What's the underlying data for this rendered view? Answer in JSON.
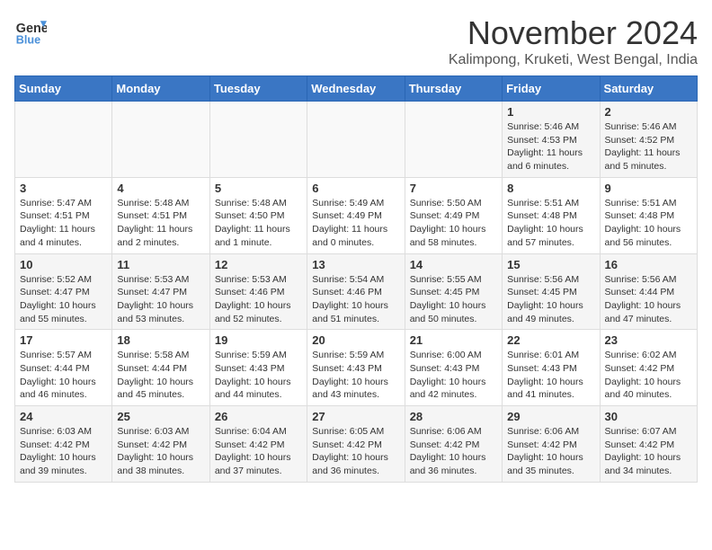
{
  "header": {
    "logo_line1": "General",
    "logo_line2": "Blue",
    "month": "November 2024",
    "location": "Kalimpong, Kruketi, West Bengal, India"
  },
  "weekdays": [
    "Sunday",
    "Monday",
    "Tuesday",
    "Wednesday",
    "Thursday",
    "Friday",
    "Saturday"
  ],
  "weeks": [
    [
      {
        "day": "",
        "info": ""
      },
      {
        "day": "",
        "info": ""
      },
      {
        "day": "",
        "info": ""
      },
      {
        "day": "",
        "info": ""
      },
      {
        "day": "",
        "info": ""
      },
      {
        "day": "1",
        "info": "Sunrise: 5:46 AM\nSunset: 4:53 PM\nDaylight: 11 hours\nand 6 minutes."
      },
      {
        "day": "2",
        "info": "Sunrise: 5:46 AM\nSunset: 4:52 PM\nDaylight: 11 hours\nand 5 minutes."
      }
    ],
    [
      {
        "day": "3",
        "info": "Sunrise: 5:47 AM\nSunset: 4:51 PM\nDaylight: 11 hours\nand 4 minutes."
      },
      {
        "day": "4",
        "info": "Sunrise: 5:48 AM\nSunset: 4:51 PM\nDaylight: 11 hours\nand 2 minutes."
      },
      {
        "day": "5",
        "info": "Sunrise: 5:48 AM\nSunset: 4:50 PM\nDaylight: 11 hours\nand 1 minute."
      },
      {
        "day": "6",
        "info": "Sunrise: 5:49 AM\nSunset: 4:49 PM\nDaylight: 11 hours\nand 0 minutes."
      },
      {
        "day": "7",
        "info": "Sunrise: 5:50 AM\nSunset: 4:49 PM\nDaylight: 10 hours\nand 58 minutes."
      },
      {
        "day": "8",
        "info": "Sunrise: 5:51 AM\nSunset: 4:48 PM\nDaylight: 10 hours\nand 57 minutes."
      },
      {
        "day": "9",
        "info": "Sunrise: 5:51 AM\nSunset: 4:48 PM\nDaylight: 10 hours\nand 56 minutes."
      }
    ],
    [
      {
        "day": "10",
        "info": "Sunrise: 5:52 AM\nSunset: 4:47 PM\nDaylight: 10 hours\nand 55 minutes."
      },
      {
        "day": "11",
        "info": "Sunrise: 5:53 AM\nSunset: 4:47 PM\nDaylight: 10 hours\nand 53 minutes."
      },
      {
        "day": "12",
        "info": "Sunrise: 5:53 AM\nSunset: 4:46 PM\nDaylight: 10 hours\nand 52 minutes."
      },
      {
        "day": "13",
        "info": "Sunrise: 5:54 AM\nSunset: 4:46 PM\nDaylight: 10 hours\nand 51 minutes."
      },
      {
        "day": "14",
        "info": "Sunrise: 5:55 AM\nSunset: 4:45 PM\nDaylight: 10 hours\nand 50 minutes."
      },
      {
        "day": "15",
        "info": "Sunrise: 5:56 AM\nSunset: 4:45 PM\nDaylight: 10 hours\nand 49 minutes."
      },
      {
        "day": "16",
        "info": "Sunrise: 5:56 AM\nSunset: 4:44 PM\nDaylight: 10 hours\nand 47 minutes."
      }
    ],
    [
      {
        "day": "17",
        "info": "Sunrise: 5:57 AM\nSunset: 4:44 PM\nDaylight: 10 hours\nand 46 minutes."
      },
      {
        "day": "18",
        "info": "Sunrise: 5:58 AM\nSunset: 4:44 PM\nDaylight: 10 hours\nand 45 minutes."
      },
      {
        "day": "19",
        "info": "Sunrise: 5:59 AM\nSunset: 4:43 PM\nDaylight: 10 hours\nand 44 minutes."
      },
      {
        "day": "20",
        "info": "Sunrise: 5:59 AM\nSunset: 4:43 PM\nDaylight: 10 hours\nand 43 minutes."
      },
      {
        "day": "21",
        "info": "Sunrise: 6:00 AM\nSunset: 4:43 PM\nDaylight: 10 hours\nand 42 minutes."
      },
      {
        "day": "22",
        "info": "Sunrise: 6:01 AM\nSunset: 4:43 PM\nDaylight: 10 hours\nand 41 minutes."
      },
      {
        "day": "23",
        "info": "Sunrise: 6:02 AM\nSunset: 4:42 PM\nDaylight: 10 hours\nand 40 minutes."
      }
    ],
    [
      {
        "day": "24",
        "info": "Sunrise: 6:03 AM\nSunset: 4:42 PM\nDaylight: 10 hours\nand 39 minutes."
      },
      {
        "day": "25",
        "info": "Sunrise: 6:03 AM\nSunset: 4:42 PM\nDaylight: 10 hours\nand 38 minutes."
      },
      {
        "day": "26",
        "info": "Sunrise: 6:04 AM\nSunset: 4:42 PM\nDaylight: 10 hours\nand 37 minutes."
      },
      {
        "day": "27",
        "info": "Sunrise: 6:05 AM\nSunset: 4:42 PM\nDaylight: 10 hours\nand 36 minutes."
      },
      {
        "day": "28",
        "info": "Sunrise: 6:06 AM\nSunset: 4:42 PM\nDaylight: 10 hours\nand 36 minutes."
      },
      {
        "day": "29",
        "info": "Sunrise: 6:06 AM\nSunset: 4:42 PM\nDaylight: 10 hours\nand 35 minutes."
      },
      {
        "day": "30",
        "info": "Sunrise: 6:07 AM\nSunset: 4:42 PM\nDaylight: 10 hours\nand 34 minutes."
      }
    ]
  ]
}
